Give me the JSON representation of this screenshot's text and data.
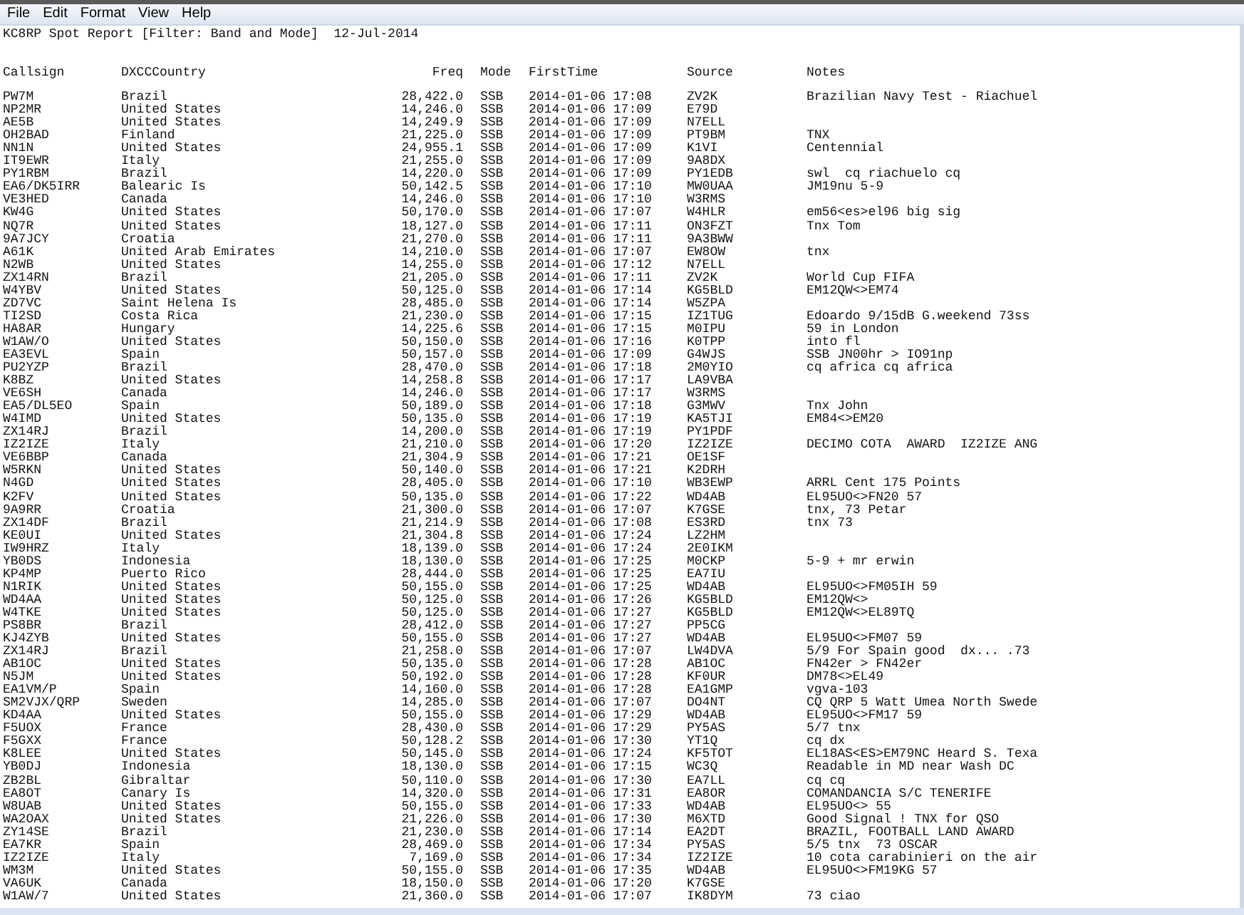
{
  "menu": [
    "File",
    "Edit",
    "Format",
    "View",
    "Help"
  ],
  "title": "KC8RP Spot Report [Filter: Band and Mode]  12-Jul-2014",
  "columns": [
    "Callsign",
    "DXCCCountry",
    "Freq",
    "Mode",
    "FirstTime",
    "Source",
    "Notes"
  ],
  "rows": [
    {
      "callsign": "PW7M",
      "country": "Brazil",
      "freq": "28,422.0",
      "mode": "SSB",
      "first_time": "2014-01-06 17:08",
      "source": "ZV2K",
      "notes": "Brazilian Navy Test - Riachuel"
    },
    {
      "callsign": "NP2MR",
      "country": "United States",
      "freq": "14,246.0",
      "mode": "SSB",
      "first_time": "2014-01-06 17:09",
      "source": "E79D"
    },
    {
      "callsign": "AE5B",
      "country": "United States",
      "freq": "14,249.9",
      "mode": "SSB",
      "first_time": "2014-01-06 17:09",
      "source": "N7ELL"
    },
    {
      "callsign": "OH2BAD",
      "country": "Finland",
      "freq": "21,225.0",
      "mode": "SSB",
      "first_time": "2014-01-06 17:09",
      "source": "PT9BM",
      "notes": "TNX"
    },
    {
      "callsign": "NN1N",
      "country": "United States",
      "freq": "24,955.1",
      "mode": "SSB",
      "first_time": "2014-01-06 17:09",
      "source": "K1VI",
      "notes": "Centennial"
    },
    {
      "callsign": "IT9EWR",
      "country": "Italy",
      "freq": "21,255.0",
      "mode": "SSB",
      "first_time": "2014-01-06 17:09",
      "source": "9A8DX"
    },
    {
      "callsign": "PY1RBM",
      "country": "Brazil",
      "freq": "14,220.0",
      "mode": "SSB",
      "first_time": "2014-01-06 17:09",
      "source": "PY1EDB",
      "notes": "swl  cq riachuelo cq"
    },
    {
      "callsign": "EA6/DK5IRR",
      "country": "Balearic Is",
      "freq": "50,142.5",
      "mode": "SSB",
      "first_time": "2014-01-06 17:10",
      "source": "MW0UAA",
      "notes": "JM19nu 5-9"
    },
    {
      "callsign": "VE3HED",
      "country": "Canada",
      "freq": "14,246.0",
      "mode": "SSB",
      "first_time": "2014-01-06 17:10",
      "source": "W3RMS"
    },
    {
      "callsign": "KW4G",
      "country": "United States",
      "freq": "50,170.0",
      "mode": "SSB",
      "first_time": "2014-01-06 17:07",
      "source": "W4HLR",
      "notes": "em56<es>el96 big sig"
    },
    {
      "callsign": "NQ7R",
      "country": "United States",
      "freq": "18,127.0",
      "mode": "SSB",
      "first_time": "2014-01-06 17:11",
      "source": "ON3FZT",
      "notes": "Tnx Tom"
    },
    {
      "callsign": "9A7JCY",
      "country": "Croatia",
      "freq": "21,270.0",
      "mode": "SSB",
      "first_time": "2014-01-06 17:11",
      "source": "9A3BWW"
    },
    {
      "callsign": "A61K",
      "country": "United Arab Emirates",
      "freq": "14,210.0",
      "mode": "SSB",
      "first_time": "2014-01-06 17:07",
      "source": "EW8OW",
      "notes": "tnx"
    },
    {
      "callsign": "N2WB",
      "country": "United States",
      "freq": "14,255.0",
      "mode": "SSB",
      "first_time": "2014-01-06 17:12",
      "source": "N7ELL"
    },
    {
      "callsign": "ZX14RN",
      "country": "Brazil",
      "freq": "21,205.0",
      "mode": "SSB",
      "first_time": "2014-01-06 17:11",
      "source": "ZV2K",
      "notes": "World Cup FIFA"
    },
    {
      "callsign": "W4YBV",
      "country": "United States",
      "freq": "50,125.0",
      "mode": "SSB",
      "first_time": "2014-01-06 17:14",
      "source": "KG5BLD",
      "notes": "EM12QW<>EM74"
    },
    {
      "callsign": "ZD7VC",
      "country": "Saint Helena Is",
      "freq": "28,485.0",
      "mode": "SSB",
      "first_time": "2014-01-06 17:14",
      "source": "W5ZPA"
    },
    {
      "callsign": "TI2SD",
      "country": "Costa Rica",
      "freq": "21,230.0",
      "mode": "SSB",
      "first_time": "2014-01-06 17:15",
      "source": "IZ1TUG",
      "notes": "Edoardo 9/15dB G.weekend 73ss"
    },
    {
      "callsign": "HA8AR",
      "country": "Hungary",
      "freq": "14,225.6",
      "mode": "SSB",
      "first_time": "2014-01-06 17:15",
      "source": "M0IPU",
      "notes": "59 in London"
    },
    {
      "callsign": "W1AW/O",
      "country": "United States",
      "freq": "50,150.0",
      "mode": "SSB",
      "first_time": "2014-01-06 17:16",
      "source": "K0TPP",
      "notes": "into fl"
    },
    {
      "callsign": "EA3EVL",
      "country": "Spain",
      "freq": "50,157.0",
      "mode": "SSB",
      "first_time": "2014-01-06 17:09",
      "source": "G4WJS",
      "notes": "SSB JN00hr > IO91np"
    },
    {
      "callsign": "PU2YZP",
      "country": "Brazil",
      "freq": "28,470.0",
      "mode": "SSB",
      "first_time": "2014-01-06 17:18",
      "source": "2M0YIO",
      "notes": "cq africa cq africa"
    },
    {
      "callsign": "K8BZ",
      "country": "United States",
      "freq": "14,258.8",
      "mode": "SSB",
      "first_time": "2014-01-06 17:17",
      "source": "LA9VBA"
    },
    {
      "callsign": "VE6SH",
      "country": "Canada",
      "freq": "14,246.0",
      "mode": "SSB",
      "first_time": "2014-01-06 17:17",
      "source": "W3RMS"
    },
    {
      "callsign": "EA5/DL5EO",
      "country": "Spain",
      "freq": "50,189.0",
      "mode": "SSB",
      "first_time": "2014-01-06 17:18",
      "source": "G3MWV",
      "notes": "Tnx John"
    },
    {
      "callsign": "W4IMD",
      "country": "United States",
      "freq": "50,135.0",
      "mode": "SSB",
      "first_time": "2014-01-06 17:19",
      "source": "KA5TJI",
      "notes": "EM84<>EM20"
    },
    {
      "callsign": "ZX14RJ",
      "country": "Brazil",
      "freq": "14,200.0",
      "mode": "SSB",
      "first_time": "2014-01-06 17:19",
      "source": "PY1PDF"
    },
    {
      "callsign": "IZ2IZE",
      "country": "Italy",
      "freq": "21,210.0",
      "mode": "SSB",
      "first_time": "2014-01-06 17:20",
      "source": "IZ2IZE",
      "notes": "DECIMO COTA  AWARD  IZ2IZE ANG"
    },
    {
      "callsign": "VE6BBP",
      "country": "Canada",
      "freq": "21,304.9",
      "mode": "SSB",
      "first_time": "2014-01-06 17:21",
      "source": "OE1SF"
    },
    {
      "callsign": "W5RKN",
      "country": "United States",
      "freq": "50,140.0",
      "mode": "SSB",
      "first_time": "2014-01-06 17:21",
      "source": "K2DRH"
    },
    {
      "callsign": "N4GD",
      "country": "United States",
      "freq": "28,405.0",
      "mode": "SSB",
      "first_time": "2014-01-06 17:10",
      "source": "WB3EWP",
      "notes": "ARRL Cent 175 Points"
    },
    {
      "callsign": "K2FV",
      "country": "United States",
      "freq": "50,135.0",
      "mode": "SSB",
      "first_time": "2014-01-06 17:22",
      "source": "WD4AB",
      "notes": "EL95UO<>FN20 57"
    },
    {
      "callsign": "9A9RR",
      "country": "Croatia",
      "freq": "21,300.0",
      "mode": "SSB",
      "first_time": "2014-01-06 17:07",
      "source": "K7GSE",
      "notes": "tnx, 73 Petar"
    },
    {
      "callsign": "ZX14DF",
      "country": "Brazil",
      "freq": "21,214.9",
      "mode": "SSB",
      "first_time": "2014-01-06 17:08",
      "source": "ES3RD",
      "notes": "tnx 73"
    },
    {
      "callsign": "KE0UI",
      "country": "United States",
      "freq": "21,304.8",
      "mode": "SSB",
      "first_time": "2014-01-06 17:24",
      "source": "LZ2HM"
    },
    {
      "callsign": "IW9HRZ",
      "country": "Italy",
      "freq": "18,139.0",
      "mode": "SSB",
      "first_time": "2014-01-06 17:24",
      "source": "2E0IKM"
    },
    {
      "callsign": "YB0DS",
      "country": "Indonesia",
      "freq": "18,130.0",
      "mode": "SSB",
      "first_time": "2014-01-06 17:25",
      "source": "M0CKP",
      "notes": "5-9 + mr erwin"
    },
    {
      "callsign": "KP4MP",
      "country": "Puerto Rico",
      "freq": "28,444.0",
      "mode": "SSB",
      "first_time": "2014-01-06 17:25",
      "source": "EA7IU"
    },
    {
      "callsign": "N1RIK",
      "country": "United States",
      "freq": "50,155.0",
      "mode": "SSB",
      "first_time": "2014-01-06 17:25",
      "source": "WD4AB",
      "notes": "EL95UO<>FM05IH 59"
    },
    {
      "callsign": "WD4AA",
      "country": "United States",
      "freq": "50,125.0",
      "mode": "SSB",
      "first_time": "2014-01-06 17:26",
      "source": "KG5BLD",
      "notes": "EM12QW<>"
    },
    {
      "callsign": "W4TKE",
      "country": "United States",
      "freq": "50,125.0",
      "mode": "SSB",
      "first_time": "2014-01-06 17:27",
      "source": "KG5BLD",
      "notes": "EM12QW<>EL89TQ"
    },
    {
      "callsign": "PS8BR",
      "country": "Brazil",
      "freq": "28,412.0",
      "mode": "SSB",
      "first_time": "2014-01-06 17:27",
      "source": "PP5CG"
    },
    {
      "callsign": "KJ4ZYB",
      "country": "United States",
      "freq": "50,155.0",
      "mode": "SSB",
      "first_time": "2014-01-06 17:27",
      "source": "WD4AB",
      "notes": "EL95UO<>FM07 59"
    },
    {
      "callsign": "ZX14RJ",
      "country": "Brazil",
      "freq": "21,258.0",
      "mode": "SSB",
      "first_time": "2014-01-06 17:07",
      "source": "LW4DVA",
      "notes": "5/9 For Spain good  dx... .73"
    },
    {
      "callsign": "AB1OC",
      "country": "United States",
      "freq": "50,135.0",
      "mode": "SSB",
      "first_time": "2014-01-06 17:28",
      "source": "AB1OC",
      "notes": "FN42er > FN42er"
    },
    {
      "callsign": "N5JM",
      "country": "United States",
      "freq": "50,192.0",
      "mode": "SSB",
      "first_time": "2014-01-06 17:28",
      "source": "KF0UR",
      "notes": "DM78<>EL49"
    },
    {
      "callsign": "EA1VM/P",
      "country": "Spain",
      "freq": "14,160.0",
      "mode": "SSB",
      "first_time": "2014-01-06 17:28",
      "source": "EA1GMP",
      "notes": "vgva-103"
    },
    {
      "callsign": "SM2VJX/QRP",
      "country": "Sweden",
      "freq": "14,285.0",
      "mode": "SSB",
      "first_time": "2014-01-06 17:07",
      "source": "DO4NT",
      "notes": "CQ QRP 5 Watt Umea North Swede"
    },
    {
      "callsign": "KD4AA",
      "country": "United States",
      "freq": "50,155.0",
      "mode": "SSB",
      "first_time": "2014-01-06 17:29",
      "source": "WD4AB",
      "notes": "EL95UO<>FM17 59"
    },
    {
      "callsign": "F5UOX",
      "country": "France",
      "freq": "28,430.0",
      "mode": "SSB",
      "first_time": "2014-01-06 17:29",
      "source": "PY5AS",
      "notes": "5/7 tnx"
    },
    {
      "callsign": "F5GXX",
      "country": "France",
      "freq": "50,128.2",
      "mode": "SSB",
      "first_time": "2014-01-06 17:30",
      "source": "YT1Q",
      "notes": "cq dx"
    },
    {
      "callsign": "K8LEE",
      "country": "United States",
      "freq": "50,145.0",
      "mode": "SSB",
      "first_time": "2014-01-06 17:24",
      "source": "KF5TOT",
      "notes": "EL18AS<ES>EM79NC Heard S. Texa"
    },
    {
      "callsign": "YB0DJ",
      "country": "Indonesia",
      "freq": "18,130.0",
      "mode": "SSB",
      "first_time": "2014-01-06 17:15",
      "source": "WC3Q",
      "notes": "Readable in MD near Wash DC"
    },
    {
      "callsign": "ZB2BL",
      "country": "Gibraltar",
      "freq": "50,110.0",
      "mode": "SSB",
      "first_time": "2014-01-06 17:30",
      "source": "EA7LL",
      "notes": "cq cq"
    },
    {
      "callsign": "EA8OT",
      "country": "Canary Is",
      "freq": "14,320.0",
      "mode": "SSB",
      "first_time": "2014-01-06 17:31",
      "source": "EA8OR",
      "notes": "COMANDANCIA S/C TENERIFE"
    },
    {
      "callsign": "W8UAB",
      "country": "United States",
      "freq": "50,155.0",
      "mode": "SSB",
      "first_time": "2014-01-06 17:33",
      "source": "WD4AB",
      "notes": "EL95UO<> 55"
    },
    {
      "callsign": "WA2OAX",
      "country": "United States",
      "freq": "21,226.0",
      "mode": "SSB",
      "first_time": "2014-01-06 17:30",
      "source": "M6XTD",
      "notes": "Good Signal ! TNX for QSO"
    },
    {
      "callsign": "ZY14SE",
      "country": "Brazil",
      "freq": "21,230.0",
      "mode": "SSB",
      "first_time": "2014-01-06 17:14",
      "source": "EA2DT",
      "notes": "BRAZIL, FOOTBALL LAND AWARD"
    },
    {
      "callsign": "EA7KR",
      "country": "Spain",
      "freq": "28,469.0",
      "mode": "SSB",
      "first_time": "2014-01-06 17:34",
      "source": "PY5AS",
      "notes": "5/5 tnx  73 OSCAR"
    },
    {
      "callsign": "IZ2IZE",
      "country": "Italy",
      "freq": "7,169.0",
      "mode": "SSB",
      "first_time": "2014-01-06 17:34",
      "source": "IZ2IZE",
      "notes": "10 cota carabinieri on the air"
    },
    {
      "callsign": "WM3M",
      "country": "United States",
      "freq": "50,155.0",
      "mode": "SSB",
      "first_time": "2014-01-06 17:35",
      "source": "WD4AB",
      "notes": "EL95UO<>FM19KG 57"
    },
    {
      "callsign": "VA6UK",
      "country": "Canada",
      "freq": "18,150.0",
      "mode": "SSB",
      "first_time": "2014-01-06 17:20",
      "source": "K7GSE"
    },
    {
      "callsign": "W1AW/7",
      "country": "United States",
      "freq": "21,360.0",
      "mode": "SSB",
      "first_time": "2014-01-06 17:07",
      "source": "IK8DYM",
      "notes": "73 ciao"
    }
  ]
}
